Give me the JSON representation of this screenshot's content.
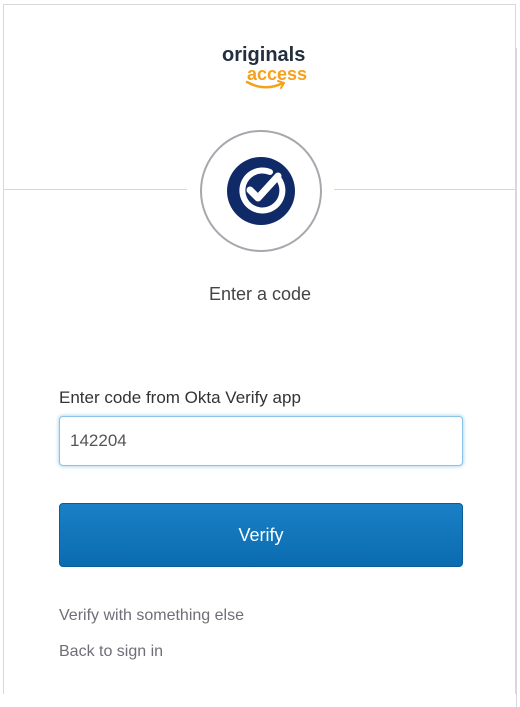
{
  "brand": {
    "logo_top": "originals",
    "logo_bottom": "access"
  },
  "icons": {
    "factor": "okta-verify-icon"
  },
  "colors": {
    "primary_button": "#0b6bb0",
    "brand_dark": "#232f3e",
    "brand_orange": "#f7a11a",
    "icon_navy": "#0f2a66"
  },
  "auth": {
    "heading": "Enter a code",
    "code_label": "Enter code from Okta Verify app",
    "code_value": "142204",
    "verify_button": "Verify",
    "verify_other_link": "Verify with something else",
    "back_link": "Back to sign in"
  }
}
